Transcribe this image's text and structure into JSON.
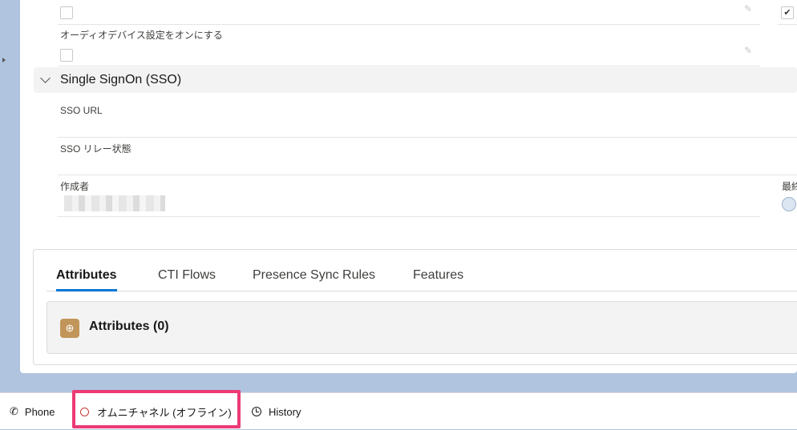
{
  "record": {
    "audio_device_label": "オーディオデバイス設定をオンにする",
    "top_checkbox_checked": false,
    "right_checkbox_checked": true,
    "audio_device_checked": false,
    "sso_section_title": "Single SignOn (SSO)",
    "sso_url_label": "SSO URL",
    "sso_relay_label": "SSO リレー状態",
    "created_by_label": "作成者",
    "last_modified_label_partial": "最終"
  },
  "related": {
    "tabs": [
      {
        "label": "Attributes",
        "active": true
      },
      {
        "label": "CTI Flows",
        "active": false
      },
      {
        "label": "Presence Sync Rules",
        "active": false
      },
      {
        "label": "Features",
        "active": false
      }
    ],
    "card_title": "Attributes (0)",
    "card_icon": "attributes-icon"
  },
  "utility_bar": {
    "phone_label": "Phone",
    "omni_label": "オムニチャネル (オフライン)",
    "history_label": "History"
  },
  "colors": {
    "background": "#b0c4df",
    "active_tab_underline": "#0176d3",
    "highlight_box": "#ec3a74",
    "offline_status": "#c23934",
    "attributes_icon": "#c2955a"
  }
}
